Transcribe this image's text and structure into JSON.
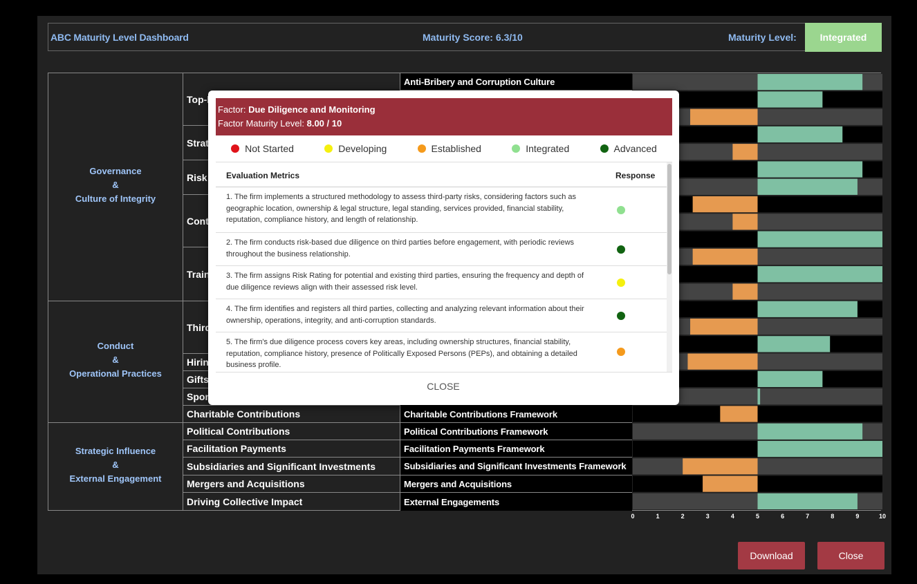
{
  "topbar": {
    "title": "ABC Maturity Level Dashboard",
    "score_label": "Maturity Score:",
    "score_value": "6.3/10",
    "level_label": "Maturity Level:",
    "level_value": "Integrated",
    "level_color": "#9bd68f"
  },
  "categories": [
    "Governance\n&\nCulture of Integrity",
    "Conduct\n&\nOperational Practices",
    "Strategic Influence\n&\nExternal Engagement"
  ],
  "factors": [
    "Top-l",
    "Strat",
    "Risk",
    "Cont",
    "Train",
    "Third",
    "Hirin",
    "Gifts",
    "Spon",
    "Charitable Contributions",
    "Political Contributions",
    "Facilitation Payments",
    "Subsidiaries and Significant Investments",
    "Mergers and Acquisitions",
    "Driving Collective Impact"
  ],
  "frameworks": [
    "Anti-Bribery and Corruption Culture",
    "Charitable Contributions Framework",
    "Political Contributions Framework",
    "Facilitation Payments Framework",
    "Subsidiaries and Significant Investments Framework",
    "Mergers and Acquisitions",
    "External Engagements"
  ],
  "chart_data": {
    "type": "bar",
    "xlim": [
      0,
      10
    ],
    "ticks": [
      "0",
      "1",
      "2",
      "3",
      "4",
      "5",
      "6",
      "7",
      "8",
      "9",
      "10"
    ],
    "colors": {
      "Established": "#e69a50",
      "Integrated": "#7fc0a3",
      "Advanced": "#7fc0a3",
      "track": "#444444"
    },
    "values": [
      9.2,
      7.6,
      2.3,
      8.4,
      4.0,
      9.2,
      9.0,
      2.4,
      4.0,
      10.0,
      2.4,
      10.0,
      4.0,
      9.0,
      2.3,
      7.9,
      2.2,
      7.6,
      5.1,
      3.5,
      9.2,
      10.0,
      2.0,
      2.8,
      9.0
    ]
  },
  "modal": {
    "factor_label": "Factor: ",
    "factor_name": "Due Diligence and Monitoring",
    "level_label": "Factor Maturity Level: ",
    "level_value": "8.00 / 10",
    "legend": [
      {
        "label": "Not Started",
        "color": "#e0131a"
      },
      {
        "label": "Developing",
        "color": "#f5f00f"
      },
      {
        "label": "Established",
        "color": "#f59a1c"
      },
      {
        "label": "Integrated",
        "color": "#90e090"
      },
      {
        "label": "Advanced",
        "color": "#116311"
      }
    ],
    "col_metrics": "Evaluation Metrics",
    "col_response": "Response",
    "metrics": [
      {
        "text": "1. The firm implements a structured methodology to assess third-party risks, considering factors such as geographic location, ownership & legal structure, legal standing, services provided, financial stability, reputation, compliance history, and length of relationship.",
        "response": "Integrated"
      },
      {
        "text": "2. The firm conducts risk-based due diligence on third parties before engagement, with periodic reviews throughout the business relationship.",
        "response": "Advanced"
      },
      {
        "text": "3. The firm assigns Risk Rating for potential and existing third parties, ensuring the frequency and depth of due diligence reviews align with their assessed risk level.",
        "response": "Developing"
      },
      {
        "text": "4. The firm identifies and registers all third parties, collecting and analyzing relevant information about their ownership, operations, integrity, and anti-corruption standards.",
        "response": "Advanced"
      },
      {
        "text": "5. The firm's due diligence process covers key areas, including ownership structures, financial stability, reputation, compliance history, presence of Politically Exposed Persons (PEPs), and obtaining a detailed business profile.",
        "response": "Established"
      }
    ],
    "close_label": "CLOSE"
  },
  "buttons": {
    "download": "Download",
    "close": "Close"
  }
}
